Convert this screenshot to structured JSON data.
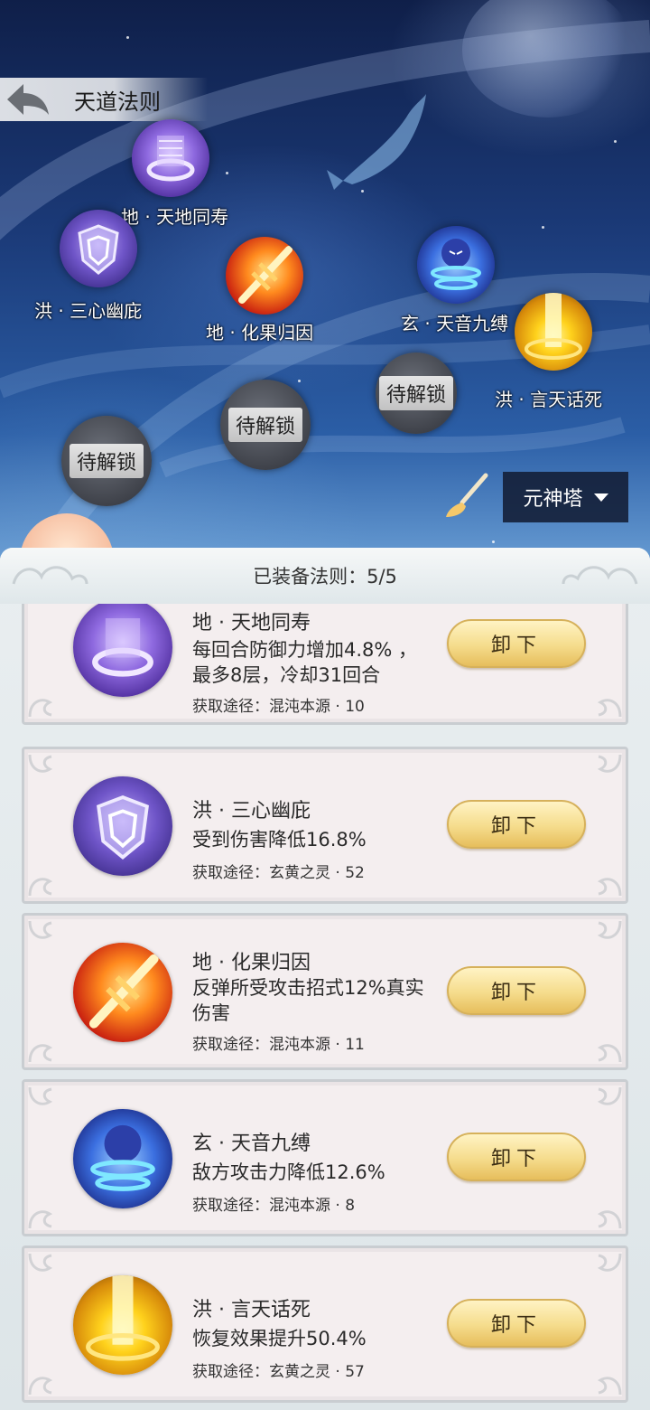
{
  "header": {
    "title": "天道法则"
  },
  "nodes": [
    {
      "label": "地 · 天地同寿",
      "icon": "purple-ring-icon"
    },
    {
      "label": "洪 · 三心幽庇",
      "icon": "purple-shield-icon"
    },
    {
      "label": "地 · 化果归因",
      "icon": "fire-sword-icon"
    },
    {
      "label": "玄 · 天音九缚",
      "icon": "blue-spirit-icon"
    },
    {
      "label": "洪 · 言天话死",
      "icon": "golden-light-icon"
    }
  ],
  "locked_nodes": [
    {
      "label": "待解锁"
    },
    {
      "label": "待解锁"
    },
    {
      "label": "待解锁"
    }
  ],
  "tower_select": {
    "value": "元神塔",
    "icon": "chevron-down-icon"
  },
  "panel": {
    "equipped_label": "已装备法则：5/5"
  },
  "cards": [
    {
      "name": "地 · 天地同寿",
      "desc": "每回合防御力增加4.8% ，最多8层，冷却31回合",
      "source": "获取途径：混沌本源 · 10",
      "button": "卸下",
      "icon": "purple-ring-icon"
    },
    {
      "name": "洪 · 三心幽庇",
      "desc": "受到伤害降低16.8%",
      "source": "获取途径：玄黄之灵 · 52",
      "button": "卸下",
      "icon": "purple-shield-icon"
    },
    {
      "name": "地 · 化果归因",
      "desc": "反弹所受攻击招式12%真实伤害",
      "source": "获取途径：混沌本源 · 11",
      "button": "卸下",
      "icon": "fire-sword-icon"
    },
    {
      "name": "玄 · 天音九缚",
      "desc": "敌方攻击力降低12.6%",
      "source": "获取途径：混沌本源 · 8",
      "button": "卸下",
      "icon": "blue-spirit-icon"
    },
    {
      "name": "洪 · 言天话死",
      "desc": "恢复效果提升50.4%",
      "source": "获取途径：玄黄之灵 · 57",
      "button": "卸下",
      "icon": "golden-light-icon"
    }
  ]
}
